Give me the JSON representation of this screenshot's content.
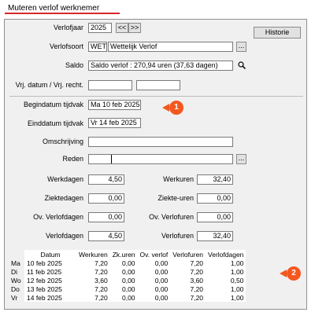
{
  "window": {
    "title": "Muteren verlof werknemer"
  },
  "buttons": {
    "historie": "Historie",
    "prev": "<<",
    "next": ">>",
    "ellipsis": "..."
  },
  "form": {
    "verlofjaar": {
      "label": "Verlofjaar",
      "value": "2025"
    },
    "verlofsoort": {
      "label": "Verlofsoort",
      "code": "WET",
      "description": "Wettelijk Verlof"
    },
    "saldo": {
      "label": "Saldo",
      "value": "Saldo verlof : 270,94 uren (37,63 dagen)"
    },
    "vrj": {
      "label": "Vrj. datum / Vrj. recht.",
      "date": "",
      "recht": ""
    },
    "begindatum": {
      "label": "Begindatum tijdvak",
      "value": "Ma 10 feb 2025"
    },
    "einddatum": {
      "label": "Einddatum tijdvak",
      "value": "Vr 14 feb 2025"
    },
    "omschrijving": {
      "label": "Omschrijving",
      "value": ""
    },
    "reden": {
      "label": "Reden",
      "value": ""
    }
  },
  "totals": {
    "werkdagen": {
      "label": "Werkdagen",
      "value": "4,50"
    },
    "werkuren": {
      "label": "Werkuren",
      "value": "32,40"
    },
    "ziektedagen": {
      "label": "Ziektedagen",
      "value": "0,00"
    },
    "ziekteuren": {
      "label": "Ziekte-uren",
      "value": "0,00"
    },
    "ov_verlofdagen": {
      "label": "Ov. Verlofdagen",
      "value": "0,00"
    },
    "ov_verlofuren": {
      "label": "Ov. Verlofuren",
      "value": "0,00"
    },
    "verlofdagen": {
      "label": "Verlofdagen",
      "value": "4,50"
    },
    "verlofuren": {
      "label": "Verlofuren",
      "value": "32,40"
    }
  },
  "table": {
    "columns": [
      "Datum",
      "Werkuren",
      "Zk.uren",
      "Ov. verlof",
      "Verlofuren",
      "Verlofdagen"
    ],
    "rows": [
      [
        "Ma",
        "10 feb 2025",
        "7,20",
        "0,00",
        "0,00",
        "7,20",
        "1,00"
      ],
      [
        "Di",
        "11 feb 2025",
        "7,20",
        "0,00",
        "0,00",
        "7,20",
        "1,00"
      ],
      [
        "Wo",
        "12 feb 2025",
        "3,60",
        "0,00",
        "0,00",
        "3,60",
        "0,50"
      ],
      [
        "Do",
        "13 feb 2025",
        "7,20",
        "0,00",
        "0,00",
        "7,20",
        "1,00"
      ],
      [
        "Vr",
        "14 feb 2025",
        "7,20",
        "0,00",
        "0,00",
        "7,20",
        "1,00"
      ]
    ]
  },
  "callouts": {
    "one": "1",
    "two": "2"
  },
  "colors": {
    "accent": "#d9262c",
    "callout": "#f4581f",
    "panel": "#f0f0f0"
  }
}
